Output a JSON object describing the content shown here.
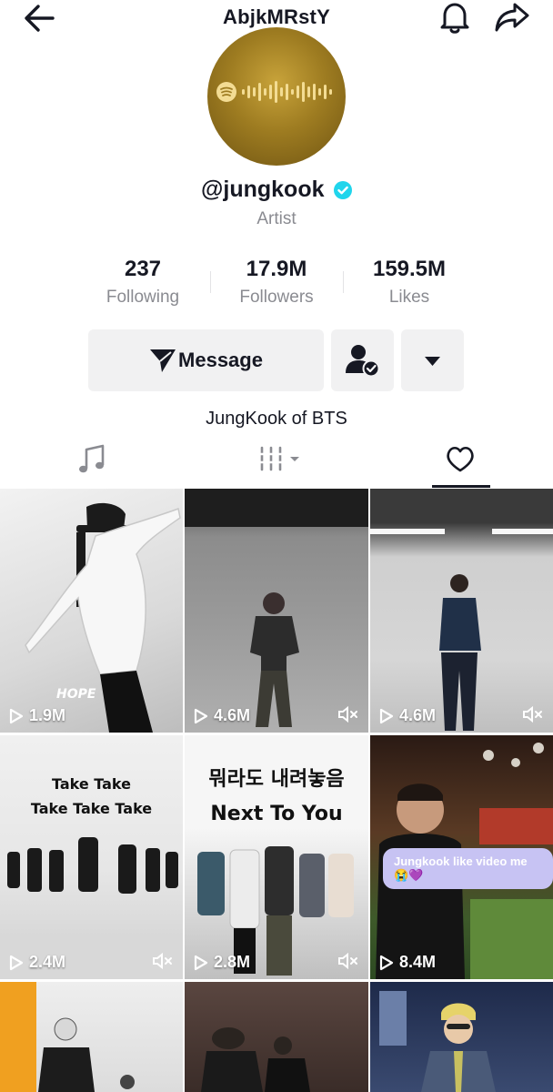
{
  "header": {
    "title": "AbjkMRstY",
    "back_icon": "arrow-left-icon",
    "bell_icon": "bell-icon",
    "share_icon": "share-arrow-icon"
  },
  "profile": {
    "avatar_icon": "spotify-code-icon",
    "handle": "@jungkook",
    "verified_icon": "verified-badge-icon",
    "subtitle": "Artist",
    "stats": [
      {
        "value": "237",
        "label": "Following"
      },
      {
        "value": "17.9M",
        "label": "Followers"
      },
      {
        "value": "159.5M",
        "label": "Likes"
      }
    ],
    "message_button": "Message",
    "bio": "JungKook of BTS",
    "colors": {
      "verified": "#20d5ec",
      "avatar_gold": "#b08a2a"
    }
  },
  "tabs": [
    {
      "icon": "music-note-icon"
    },
    {
      "icon": "playlist-bars-icon"
    },
    {
      "icon": "heart-icon",
      "active": true
    }
  ],
  "videos": [
    {
      "views": "1.9M",
      "muted": false,
      "overlay": "HOPE"
    },
    {
      "views": "4.6M",
      "muted": true
    },
    {
      "views": "4.6M",
      "muted": true
    },
    {
      "views": "2.4M",
      "muted": true,
      "overlay_lines": [
        "Take  Take",
        "Take  Take  Take"
      ]
    },
    {
      "views": "2.8M",
      "muted": true,
      "overlay_lines": [
        "뭐라도 내려놓음",
        "Next To You"
      ]
    },
    {
      "views": "8.4M",
      "muted": false,
      "overlay_pill": "Jungkook like video me 😭💜"
    },
    {
      "views": ""
    },
    {
      "views": ""
    },
    {
      "views": ""
    }
  ]
}
